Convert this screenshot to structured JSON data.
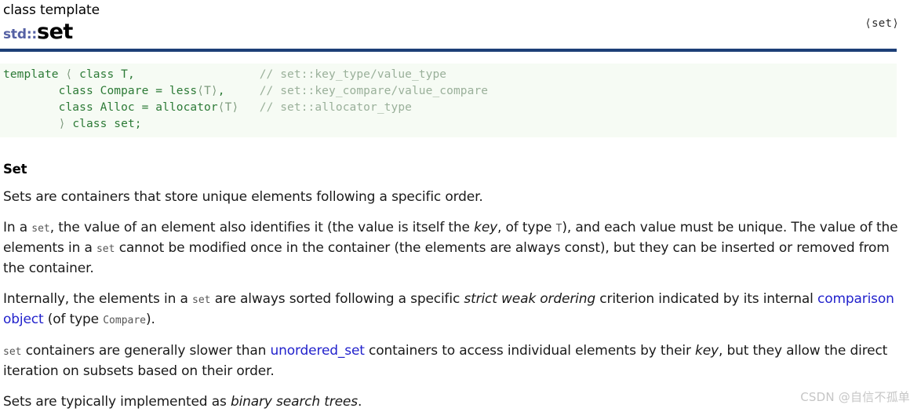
{
  "header": {
    "kicker": "class template",
    "namespace": "std::",
    "name": "set",
    "header_link": "⟨set⟩"
  },
  "code_block": {
    "lines": [
      {
        "code": "template ",
        "punct": "⟨",
        "code2": " class T,",
        "pad": 26,
        "comment": "// set::key_type/value_type"
      },
      {
        "code": "        class Compare = less",
        "punct": "⟨T⟩",
        "code2": ",",
        "pad": 15,
        "comment": "// set::key_compare/value_compare"
      },
      {
        "code": "        class Alloc = allocator",
        "punct": "⟨T⟩",
        "code2": "",
        "pad": 13,
        "comment": "// set::allocator_type"
      },
      {
        "code": "        ",
        "punct": "⟩",
        "code2": " class set;",
        "pad": 0,
        "comment": ""
      }
    ],
    "full_text": "template ⟨ class T,                  // set::key_type/value_type\n        class Compare = less⟨T⟩,     // set::key_compare/value_compare\n        class Alloc = allocator⟨T⟩   // set::allocator_type\n        ⟩ class set;"
  },
  "section": {
    "title": "Set"
  },
  "paragraphs": {
    "p1": "Sets are containers that store unique elements following a specific order.",
    "p2": {
      "t1": "In a ",
      "c1": "set",
      "t2": ", the value of an element also identifies it (the value is itself the ",
      "i1": "key",
      "t3": ", of type ",
      "c2": "T",
      "t4": "), and each value must be unique. The value of the elements in a ",
      "c3": "set",
      "t5": " cannot be modified once in the container (the elements are always const), but they can be inserted or removed from the container."
    },
    "p3": {
      "t1": "Internally, the elements in a ",
      "c1": "set",
      "t2": " are always sorted following a specific ",
      "i1": "strict weak ordering",
      "t3": " criterion indicated by its internal ",
      "link1": "comparison object",
      "t4": " (of type ",
      "c2": "Compare",
      "t5": ")."
    },
    "p4": {
      "c1": "set",
      "t1": " containers are generally slower than ",
      "link1": "unordered_set",
      "t2": " containers to access individual elements by their ",
      "i1": "key",
      "t3": ", but they allow the direct iteration on subsets based on their order."
    },
    "p5": {
      "t1": "Sets are typically implemented as ",
      "i1": "binary search trees",
      "t2": "."
    }
  },
  "watermark": "CSDN @自信不孤单",
  "colors": {
    "rule": "#1d3f77",
    "code_bg": "#f6fbf4",
    "code_fg": "#2c7a36",
    "code_comment": "#9ab09a",
    "namespace": "#5561a4",
    "link": "#2222cc",
    "inline_code": "#555555",
    "watermark": "#c6c6c6"
  }
}
